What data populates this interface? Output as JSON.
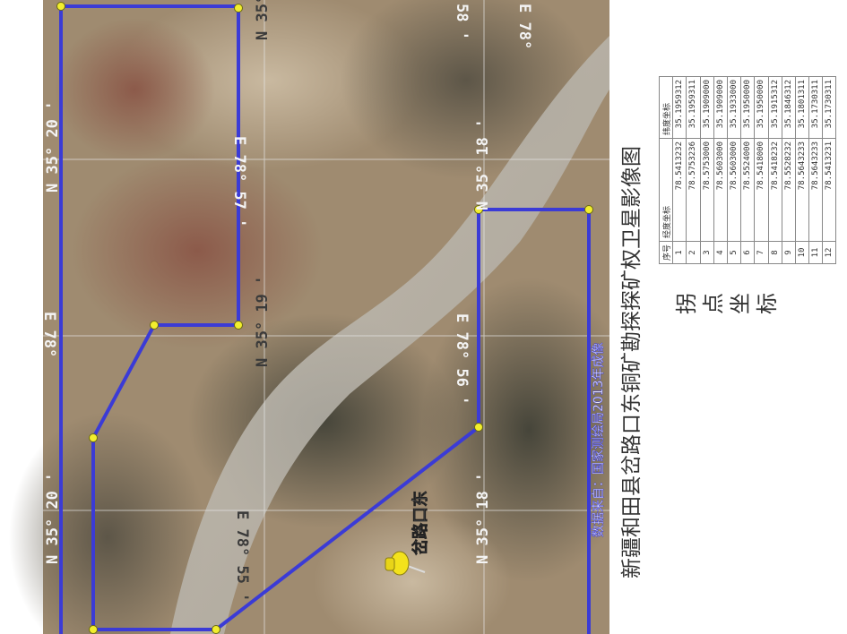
{
  "map": {
    "grid_labels": {
      "top_left": "N 35° 20 '",
      "top_right": "N 35°",
      "mid_top": "N 35° 19 '",
      "lon_57": "E 78° 57 '",
      "lon_56": "E 78° 56 '",
      "lon_55": "E 78° 55 '",
      "lon_edge": "E 78°",
      "lon_edge2": "E 78°",
      "lat_18_bottom": "N 35° 18 '",
      "lat_18_top": "N 35° 18 '",
      "lat_20_bottom": "N 35° 20 '",
      "lon_56_top": "E 78° 56 '",
      "top_edge_a": "58 '",
      "top_edge_b": "E 78°"
    },
    "placemark_label": "岔路口东",
    "watermark": "数据来自：国家测绘局2013年成像",
    "colors": {
      "boundary": "#3b3bd6",
      "vertex": "#f2ee2e",
      "placemark": "#f3e21c"
    }
  },
  "title": "新疆和田县岔路口东铜矿勘探探矿权卫星影像图",
  "side_label": [
    "拐",
    "点",
    "坐",
    "标"
  ],
  "coord_table": {
    "headers": [
      "序号",
      "经度坐标",
      "纬度坐标"
    ],
    "rows": [
      [
        "1",
        "78.5413232",
        "35.1959312"
      ],
      [
        "2",
        "78.5753236",
        "35.1959311"
      ],
      [
        "3",
        "78.5753000",
        "35.1909000"
      ],
      [
        "4",
        "78.5603000",
        "35.1909000"
      ],
      [
        "5",
        "78.5603000",
        "35.1933000"
      ],
      [
        "6",
        "78.5524000",
        "35.1950000"
      ],
      [
        "7",
        "78.5418000",
        "35.1950000"
      ],
      [
        "8",
        "78.5418232",
        "35.1915312"
      ],
      [
        "9",
        "78.5528232",
        "35.1846312"
      ],
      [
        "10",
        "78.5643233",
        "35.1801311"
      ],
      [
        "11",
        "78.5643233",
        "35.1730311"
      ],
      [
        "12",
        "78.5413231",
        "35.1730311"
      ]
    ]
  }
}
